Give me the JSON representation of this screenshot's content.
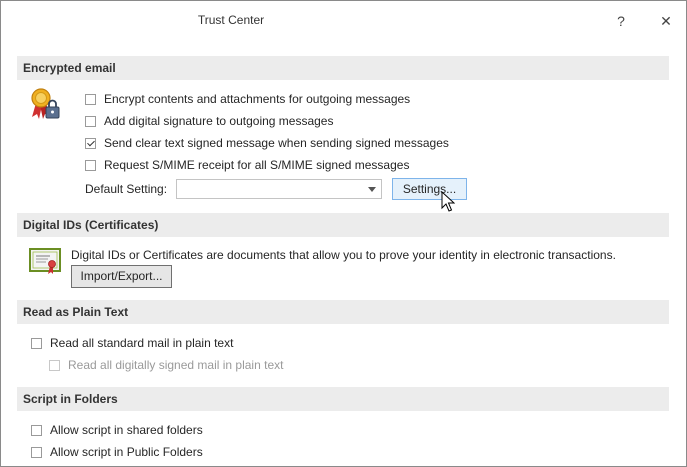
{
  "window": {
    "title": "Trust Center",
    "help_icon": "?",
    "close_icon": "✕"
  },
  "encrypted_email": {
    "heading": "Encrypted email",
    "icon": "certificate-ribbon-lock-icon",
    "options": [
      {
        "label": "Encrypt contents and attachments for outgoing messages",
        "checked": false
      },
      {
        "label": "Add digital signature to outgoing messages",
        "checked": false
      },
      {
        "label": "Send clear text signed message when sending signed messages",
        "checked": true
      },
      {
        "label": "Request S/MIME receipt for all S/MIME signed messages",
        "checked": false
      }
    ],
    "default_setting_label": "Default Setting:",
    "default_setting_value": "",
    "settings_button": "Settings..."
  },
  "digital_ids": {
    "heading": "Digital IDs (Certificates)",
    "icon": "certificate-document-icon",
    "description": "Digital IDs or Certificates are documents that allow you to prove your identity in electronic transactions.",
    "import_export_button": "Import/Export..."
  },
  "plain_text": {
    "heading": "Read as Plain Text",
    "options": [
      {
        "label": "Read all standard mail in plain text",
        "checked": false,
        "enabled": true
      },
      {
        "label": "Read all digitally signed mail in plain text",
        "checked": false,
        "enabled": false
      }
    ]
  },
  "script_folders": {
    "heading": "Script in Folders",
    "options": [
      {
        "label": "Allow script in shared folders",
        "checked": false
      },
      {
        "label": "Allow script in Public Folders",
        "checked": false
      }
    ]
  },
  "colors": {
    "section_bg": "#ececec",
    "hover_button_bg": "#e5f1fb",
    "hover_button_border": "#7eb4ea"
  }
}
